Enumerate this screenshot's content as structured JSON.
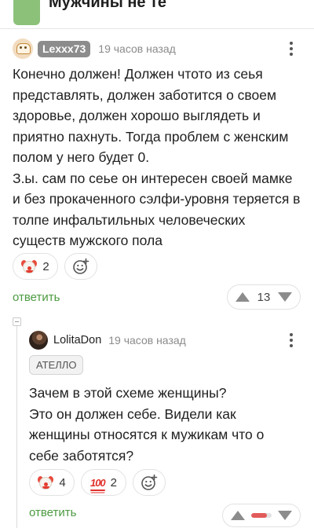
{
  "previous_comment": {
    "title": "Мужчины не те"
  },
  "comment": {
    "username": "Lexxx73",
    "time": "19 часов назад",
    "text": "Конечно должен! Должен чтото из сеья\nпредставлять, должен заботится о своем\nздоровье, должен хорошо выглядеть и\nприятно пахнуть. Тогда проблем с женским\nполом у него будет 0.\nЗ.ы. сам по сеье он интересен своей мамке\nи без прокаченного сэлфи-уровня теряется в\nтолпе инфальтильных человеческих\nсуществ мужского пола",
    "reactions": [
      {
        "icon": "clown-face-emoji",
        "count": "2"
      }
    ],
    "reply_label": "ответить",
    "rating": "13"
  },
  "reply": {
    "username": "LolitaDon",
    "time": "19 часов назад",
    "tag": "АТЕЛЛО",
    "text": "Зачем в этой схеме женщины?\nЭто он должен себе. Видели как\nженщины относятся к мужикам что о\nсебе заботятся?",
    "reactions": [
      {
        "icon": "clown-face-emoji",
        "count": "4"
      },
      {
        "icon": "hundred-points-emoji",
        "count": "2"
      }
    ],
    "reply_label": "ответить",
    "rating_fill": 0.75
  },
  "colors": {
    "accent_green": "#4c9a41",
    "downvote_red": "#e25b5b"
  }
}
